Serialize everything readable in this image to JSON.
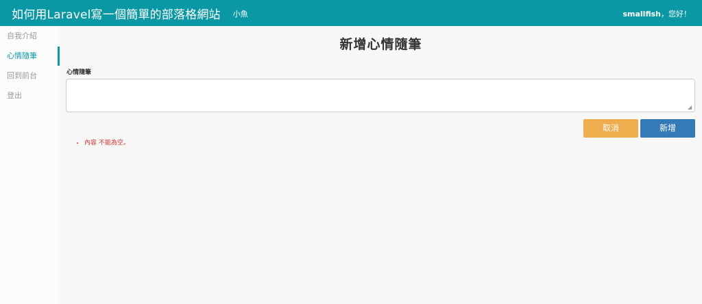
{
  "header": {
    "title": "如何用Laravel寫一個簡單的部落格網站",
    "subtitle": "小魚",
    "user_name": "smallfish",
    "greeting_suffix": "，您好！"
  },
  "sidebar": {
    "items": [
      {
        "label": "自我介紹",
        "active": false
      },
      {
        "label": "心情隨筆",
        "active": true
      },
      {
        "label": "回到前台",
        "active": false
      },
      {
        "label": "登出",
        "active": false
      }
    ]
  },
  "main": {
    "title": "新增心情隨筆",
    "field_label": "心情隨筆",
    "textarea_value": "",
    "cancel_label": "取消",
    "submit_label": "新增",
    "errors": [
      "內容 不能為空。"
    ]
  },
  "colors": {
    "header_bg": "#0b98a5",
    "cancel_bg": "#f0ad4e",
    "submit_bg": "#337ab7",
    "error": "#d9312b"
  }
}
